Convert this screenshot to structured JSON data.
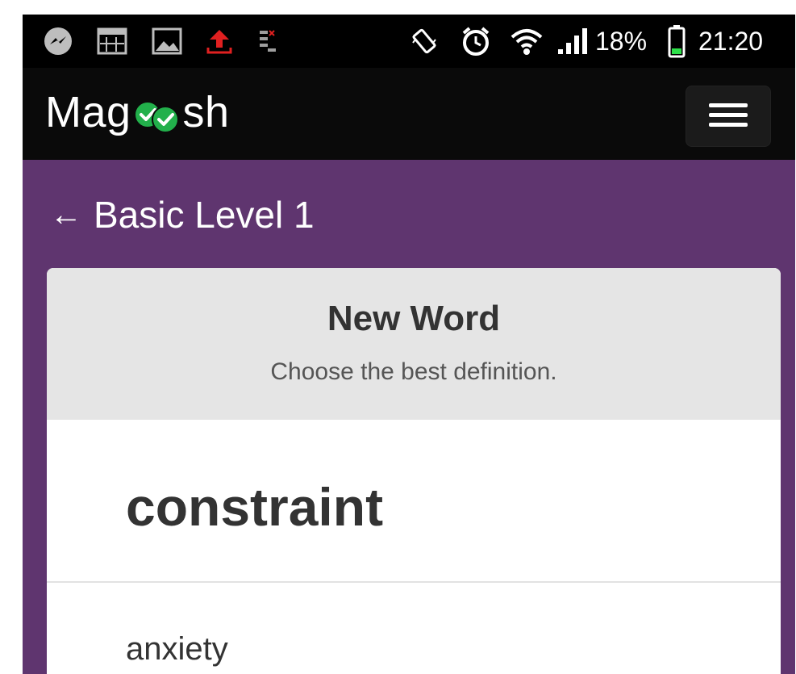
{
  "status_bar": {
    "battery_percent": "18%",
    "time": "21:20",
    "icons": [
      "messenger-icon",
      "calendar-icon",
      "gallery-icon",
      "upload-icon",
      "data-icon",
      "vibrate-icon",
      "alarm-icon",
      "wifi-icon",
      "signal-icon",
      "battery-icon"
    ]
  },
  "app_bar": {
    "logo_left": "Mag",
    "logo_right": "sh",
    "menu_icon": "hamburger-icon"
  },
  "nav": {
    "back_arrow": "←",
    "title": "Basic Level 1"
  },
  "card": {
    "title": "New Word",
    "subtitle": "Choose the best definition.",
    "word": "constraint",
    "options": [
      "anxiety"
    ]
  },
  "colors": {
    "purple": "#5f356f",
    "check_green": "#22b04b"
  }
}
